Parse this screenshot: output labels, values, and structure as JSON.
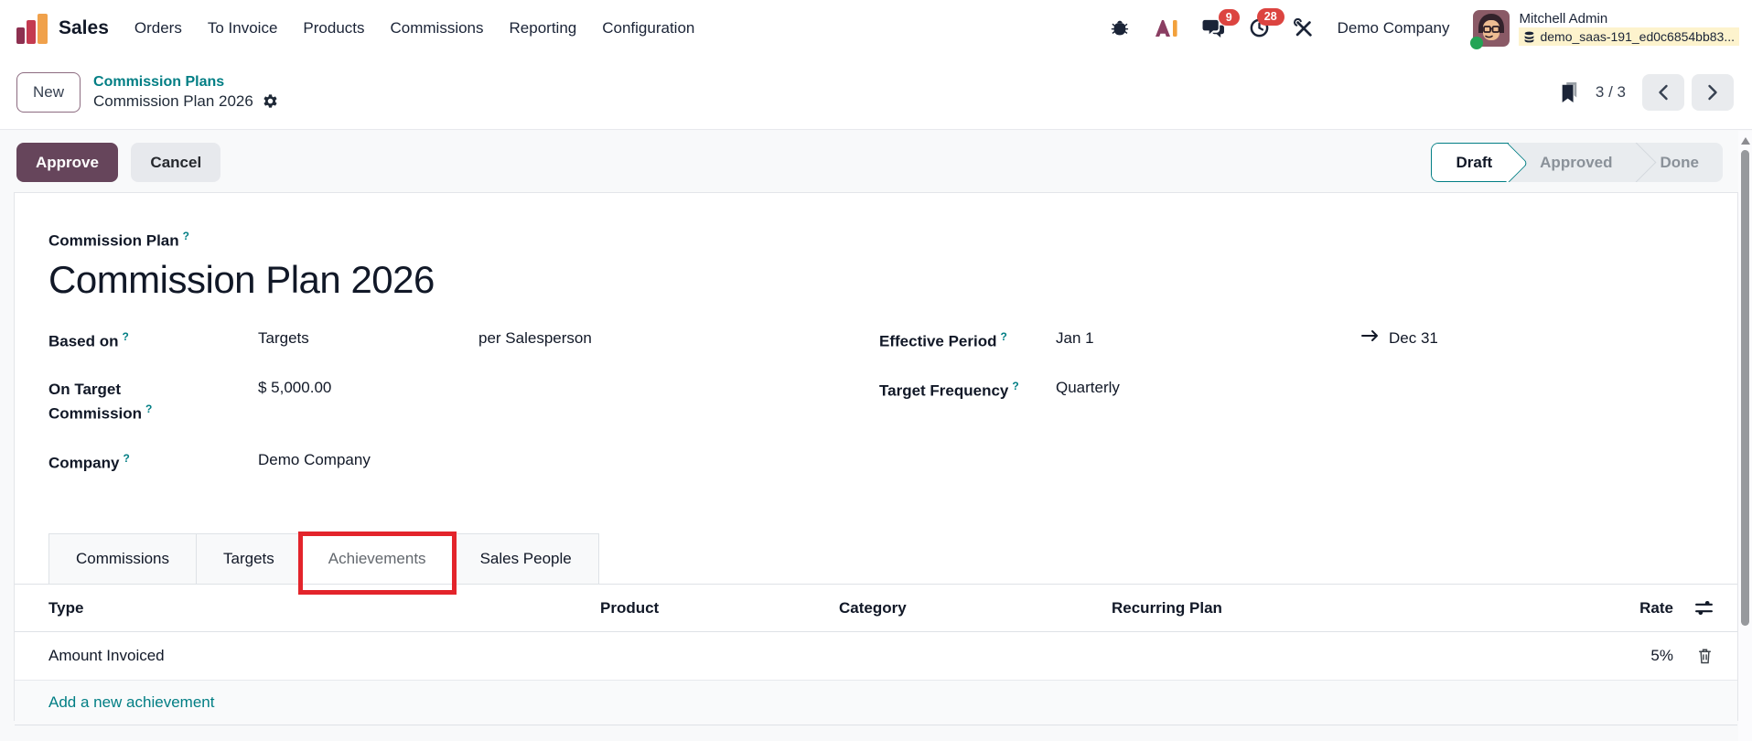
{
  "nav": {
    "app_name": "Sales",
    "menu": [
      "Orders",
      "To Invoice",
      "Products",
      "Commissions",
      "Reporting",
      "Configuration"
    ],
    "badges": {
      "messages": "9",
      "activities": "28"
    },
    "company": "Demo Company",
    "user": {
      "name": "Mitchell Admin",
      "database": "demo_saas-191_ed0c6854bb83..."
    }
  },
  "breadcrumb": {
    "new_label": "New",
    "parent": "Commission Plans",
    "current": "Commission Plan 2026",
    "pager": "3 / 3"
  },
  "control_panel": {
    "approve_label": "Approve",
    "cancel_label": "Cancel",
    "statusbar": {
      "steps": [
        "Draft",
        "Approved",
        "Done"
      ],
      "active": "Draft"
    }
  },
  "form": {
    "help_marker": "?",
    "title_label": "Commission Plan",
    "title": "Commission Plan 2026",
    "based_on": {
      "label": "Based on",
      "value": "Targets",
      "value2": "per Salesperson"
    },
    "on_target_commission": {
      "label": "On Target Commission",
      "value": "$ 5,000.00"
    },
    "company": {
      "label": "Company",
      "value": "Demo Company"
    },
    "effective_period": {
      "label": "Effective Period",
      "start": "Jan 1",
      "end": "Dec 31"
    },
    "target_frequency": {
      "label": "Target Frequency",
      "value": "Quarterly"
    }
  },
  "tabs": {
    "items": [
      "Commissions",
      "Targets",
      "Achievements",
      "Sales People"
    ],
    "active": "Achievements"
  },
  "achievements_table": {
    "columns": [
      "Type",
      "Product",
      "Category",
      "Recurring Plan",
      "Rate"
    ],
    "rows": [
      {
        "type": "Amount Invoiced",
        "product": "",
        "category": "",
        "recurring_plan": "",
        "rate": "5%"
      }
    ],
    "add_label": "Add a new achievement"
  },
  "colors": {
    "accent_teal": "#017e84",
    "primary_purple": "#66455b",
    "badge_red": "#dc4440",
    "annotation_red": "#e3242b",
    "db_highlight": "#fdf3cd",
    "status_green": "#23a455"
  }
}
